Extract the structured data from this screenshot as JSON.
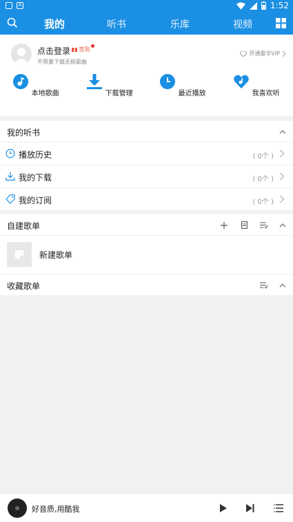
{
  "status_bar": {
    "time": "1:52"
  },
  "nav": {
    "tabs": [
      {
        "label": "我的",
        "active": true
      },
      {
        "label": "听书",
        "active": false
      },
      {
        "label": "乐库",
        "active": false
      },
      {
        "label": "视频",
        "active": false
      }
    ]
  },
  "profile": {
    "login_label": "点击登录",
    "gift_label": "签到",
    "subtitle": "不限量下载无损歌曲",
    "vip_label": "开通豪华VIP"
  },
  "quick_actions": [
    {
      "label": "本地歌曲",
      "icon": "music-note-icon"
    },
    {
      "label": "下载管理",
      "icon": "download-icon"
    },
    {
      "label": "最近播放",
      "icon": "clock-icon"
    },
    {
      "label": "我喜欢听",
      "icon": "heart-icon"
    }
  ],
  "audiobooks": {
    "title": "我的听书",
    "rows": [
      {
        "label": "播放历史",
        "count": "( 0个 )",
        "icon": "history-icon"
      },
      {
        "label": "我的下载",
        "count": "( 0个 )",
        "icon": "download-icon"
      },
      {
        "label": "我的订阅",
        "count": "( 0个 )",
        "icon": "tag-icon"
      }
    ]
  },
  "my_playlists": {
    "title": "自建歌单",
    "new_label": "新建歌单"
  },
  "fav_playlists": {
    "title": "收藏歌单"
  },
  "player": {
    "text": "好音质,用酷我"
  },
  "colors": {
    "primary": "#1a8fe3",
    "accent_red": "#e8553a"
  }
}
